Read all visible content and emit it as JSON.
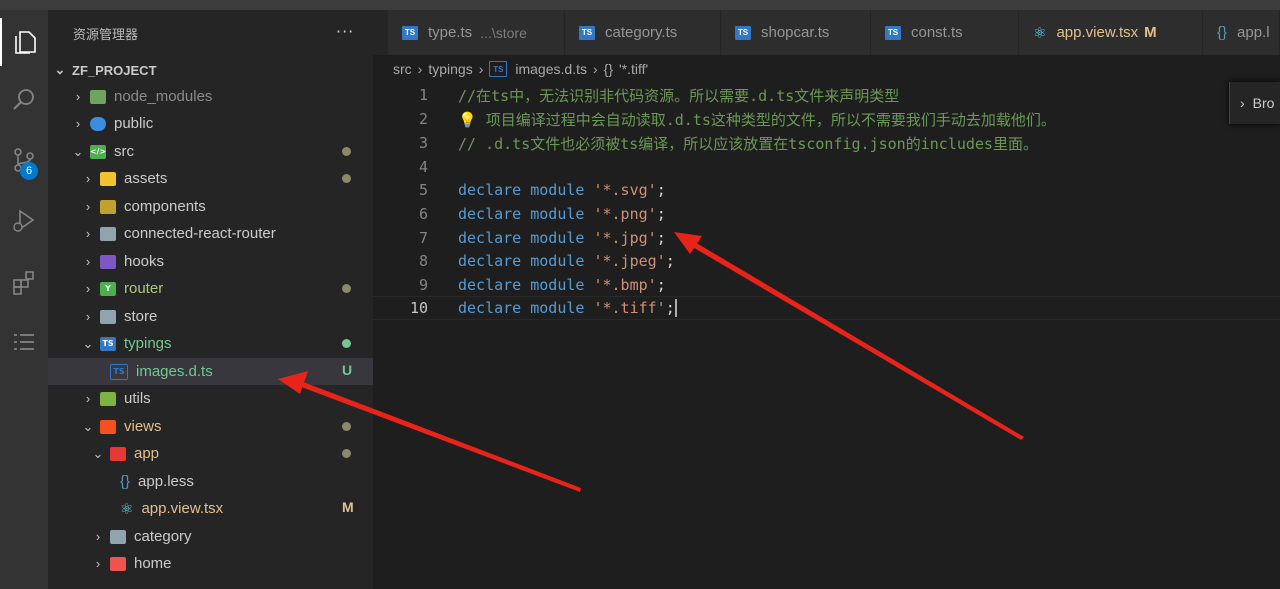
{
  "explorer": {
    "title": "资源管理器",
    "more": "···",
    "project": "ZF_PROJECT",
    "items": [
      {
        "label": "node_modules",
        "icon": "node-modules-folder-icon",
        "expanded": false,
        "dimmed": true
      },
      {
        "label": "public",
        "icon": "public-folder-icon",
        "expanded": false
      },
      {
        "label": "src",
        "icon": "src-folder-icon",
        "expanded": true
      },
      {
        "label": "assets",
        "icon": "assets-folder-icon",
        "expanded": false
      },
      {
        "label": "components",
        "icon": "components-folder-icon",
        "expanded": false
      },
      {
        "label": "connected-react-router",
        "icon": "folder-icon",
        "expanded": false
      },
      {
        "label": "hooks",
        "icon": "hooks-folder-icon",
        "expanded": false
      },
      {
        "label": "router",
        "icon": "router-folder-icon",
        "expanded": false
      },
      {
        "label": "store",
        "icon": "folder-icon",
        "expanded": false
      },
      {
        "label": "typings",
        "icon": "typings-folder-icon",
        "expanded": true
      },
      {
        "label": "images.d.ts",
        "icon": "typescript-file-icon",
        "status": "U"
      },
      {
        "label": "utils",
        "icon": "utils-folder-icon",
        "expanded": false
      },
      {
        "label": "views",
        "icon": "views-folder-icon",
        "expanded": true
      },
      {
        "label": "app",
        "icon": "app-folder-icon",
        "expanded": true
      },
      {
        "label": "app.less",
        "icon": "less-file-icon"
      },
      {
        "label": "app.view.tsx",
        "icon": "react-file-icon",
        "status": "M"
      },
      {
        "label": "category",
        "icon": "folder-icon",
        "expanded": false
      },
      {
        "label": "home",
        "icon": "home-folder-icon",
        "expanded": false
      }
    ]
  },
  "activity": {
    "scm_badge": "6"
  },
  "tabs": [
    {
      "label": "type.ts",
      "desc": "...\\store"
    },
    {
      "label": "category.ts"
    },
    {
      "label": "shopcar.ts"
    },
    {
      "label": "const.ts"
    },
    {
      "label": "app.view.tsx",
      "mod": "M"
    },
    {
      "label": "app.l"
    }
  ],
  "breadcrumb": {
    "parts": [
      "src",
      "typings",
      "images.d.ts",
      "'*.tiff'"
    ]
  },
  "editor": {
    "line_numbers": [
      "1",
      "2",
      "3",
      "4",
      "5",
      "6",
      "7",
      "8",
      "9",
      "10"
    ],
    "comments": [
      "//在ts中，无法识别非代码资源。所以需要.d.ts文件来声明类型",
      " 项目编译过程中会自动读取.d.ts这种类型的文件，所以不需要我们手动去加载他们。",
      "// .d.ts文件也必须被ts编译，所以应该放置在tsconfig.json的includes里面。"
    ],
    "keyword1": "declare",
    "keyword2": "module",
    "strings": [
      "'*.svg'",
      "'*.png'",
      "'*.jpg'",
      "'*.jpeg'",
      "'*.bmp'",
      "'*.tiff'"
    ],
    "semicolon": ";"
  },
  "peek": {
    "label": "Bro"
  },
  "colors": {
    "accent": "#007acc",
    "arrow": "#e8231a",
    "modified": "#e2c08d",
    "untracked": "#73c991"
  }
}
